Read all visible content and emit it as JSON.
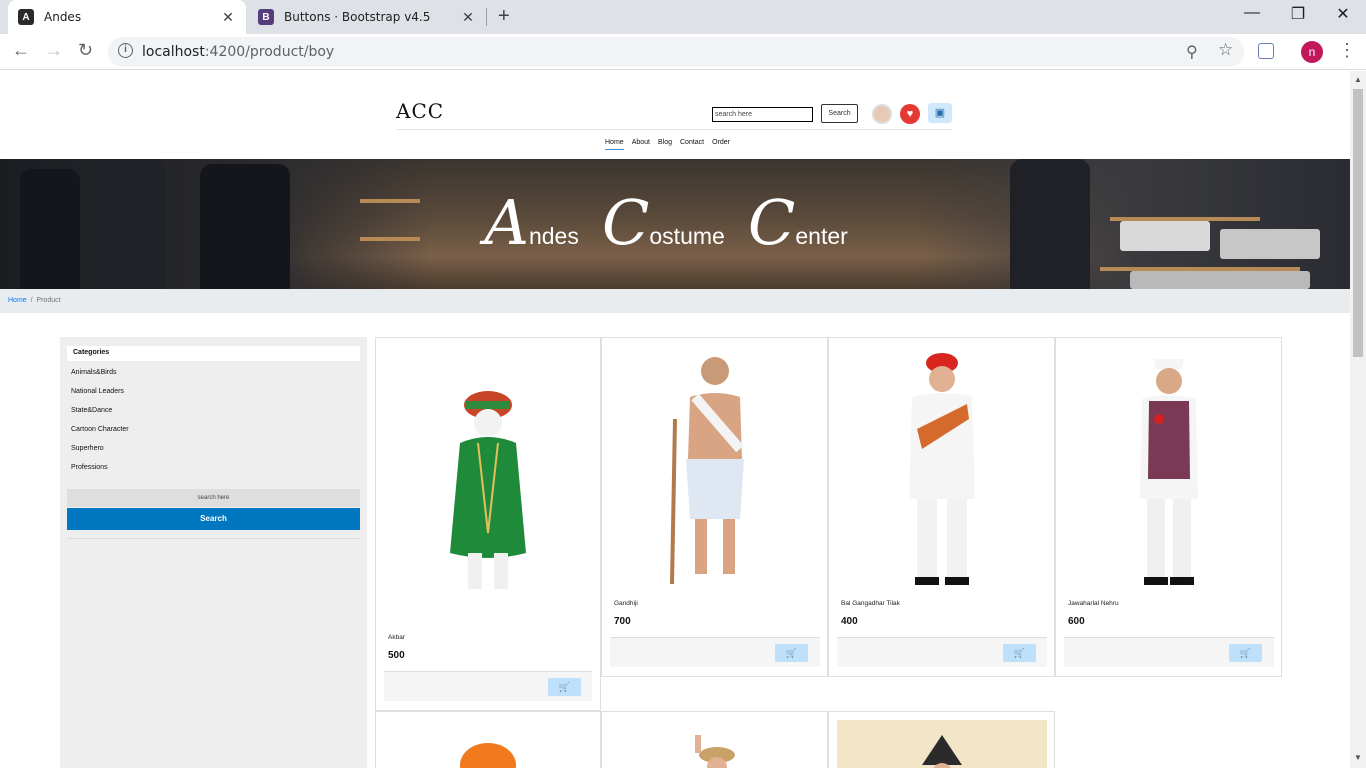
{
  "browser": {
    "tabs": [
      {
        "title": "Andes",
        "icon": "angular-icon"
      },
      {
        "title": "Buttons · Bootstrap v4.5",
        "icon": "bootstrap-icon"
      }
    ],
    "url_host": "localhost",
    "url_rest": ":4200/product/boy",
    "profile_initial": "n"
  },
  "header": {
    "logo": "ACC",
    "search_placeholder": "search here",
    "search_button": "Search",
    "nav": [
      "Home",
      "About",
      "Blog",
      "Contact",
      "Order"
    ]
  },
  "banner": {
    "words": [
      {
        "initial": "A",
        "rest": "ndes"
      },
      {
        "initial": "C",
        "rest": "ostume"
      },
      {
        "initial": "C",
        "rest": "enter"
      }
    ]
  },
  "breadcrumb": {
    "home": "Home",
    "current": "Product"
  },
  "sidebar": {
    "header": "Categories",
    "categories": [
      "Animals&Birds",
      "National Leaders",
      "State&Dance",
      "Cartoon Character",
      "Superhero",
      "Professions"
    ],
    "search_placeholder": "search here",
    "search_button": "Search"
  },
  "products": [
    {
      "name": "Akbar",
      "price": "500"
    },
    {
      "name": "Gandhiji",
      "price": "700"
    },
    {
      "name": "Bal Gangadhar Tilak",
      "price": "400"
    },
    {
      "name": "Jawaharlal Nehru",
      "price": "600"
    }
  ],
  "colors": {
    "accent": "#0077c0",
    "link": "#007bff",
    "cart_button_bg": "#bfe0fb"
  }
}
